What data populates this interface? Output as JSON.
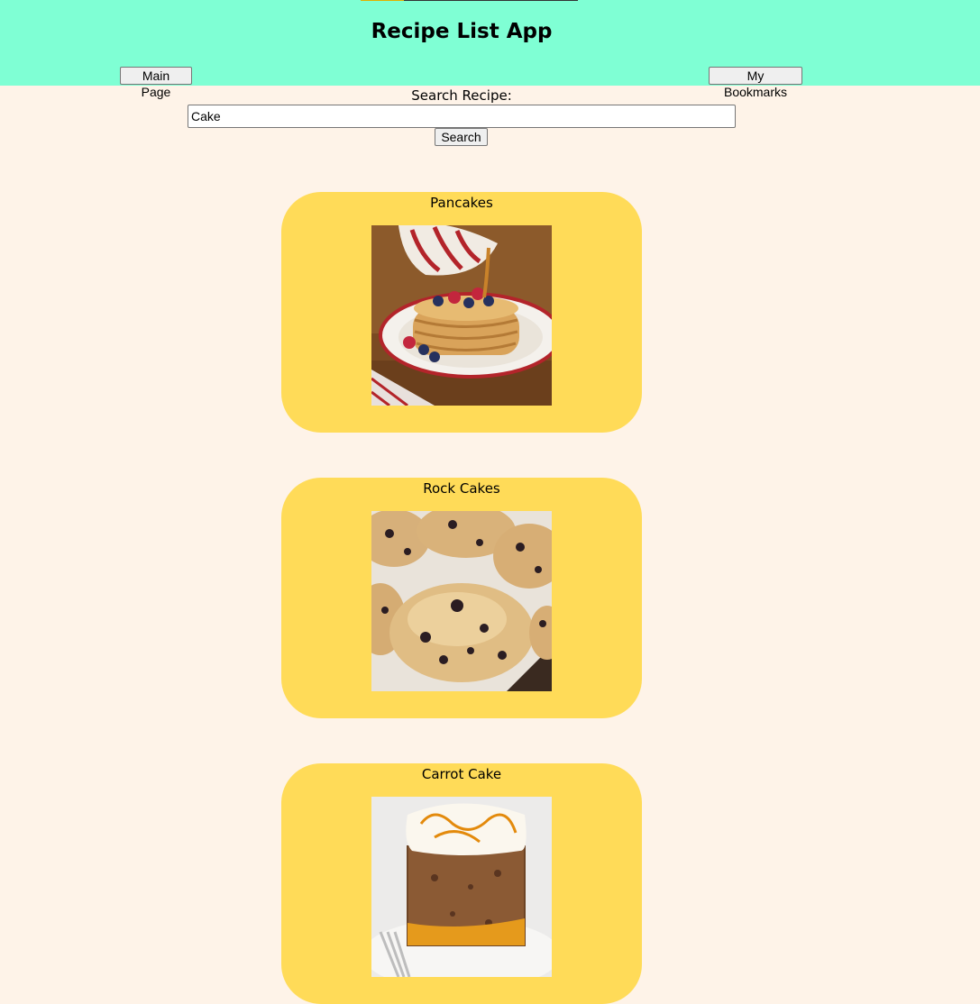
{
  "header": {
    "title": "Recipe List App",
    "main_page_label": "Main Page",
    "bookmarks_label": "My Bookmarks"
  },
  "search": {
    "label": "Search Recipe:",
    "value": "Cake",
    "button_label": "Search"
  },
  "recipes": [
    {
      "title": "Pancakes",
      "image": "pancakes-photo"
    },
    {
      "title": "Rock Cakes",
      "image": "rock-cakes-photo"
    },
    {
      "title": "Carrot Cake",
      "image": "carrot-cake-photo"
    }
  ],
  "colors": {
    "header_bg": "#7fffd4",
    "page_bg": "#fef3e8",
    "card_bg": "#ffdb58"
  }
}
